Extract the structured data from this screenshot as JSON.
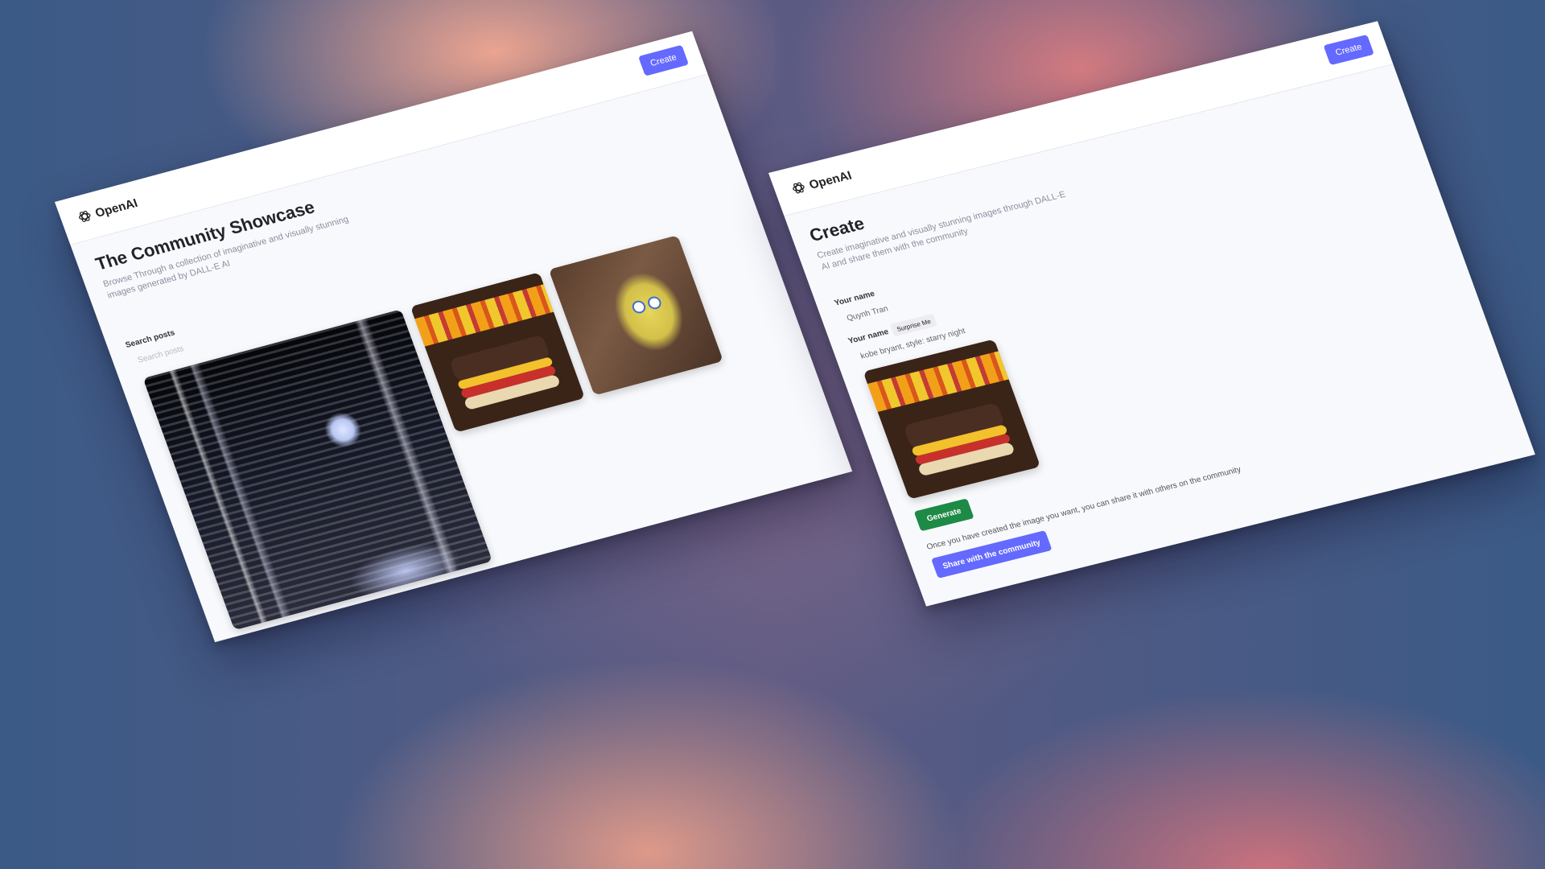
{
  "showcase_page": {
    "logo_text": "OpenAI",
    "create_label": "Create",
    "title": "The Community Showcase",
    "subtitle": "Browse Through a collection of imaginative and visually stunning images generated by DALL-E AI",
    "search_label": "Search posts",
    "search_placeholder": "Search posts",
    "gallery": [
      {
        "subject": "neon city street at night"
      },
      {
        "subject": "rubik cube burger"
      },
      {
        "subject": "spongebob in wall"
      }
    ]
  },
  "create_page": {
    "logo_text": "OpenAI",
    "create_label": "Create",
    "title": "Create",
    "subtitle": "Create imaginative and visually stunning images through DALL-E AI and share them with the community",
    "name_label": "Your name",
    "name_value": "Quynh Tran",
    "prompt_label": "Your name",
    "surprise_label": "Surprise Me",
    "prompt_value": "kobe bryant, style: starry night",
    "preview_subject": "rubik cube burger",
    "generate_label": "Generate",
    "share_note": "Once you have created the image you want, you can share it with others on the community",
    "share_label": "Share with the community"
  },
  "colors": {
    "accent": "#6469ff",
    "generate": "#1d8a45",
    "page_bg": "#f8f9fd"
  }
}
